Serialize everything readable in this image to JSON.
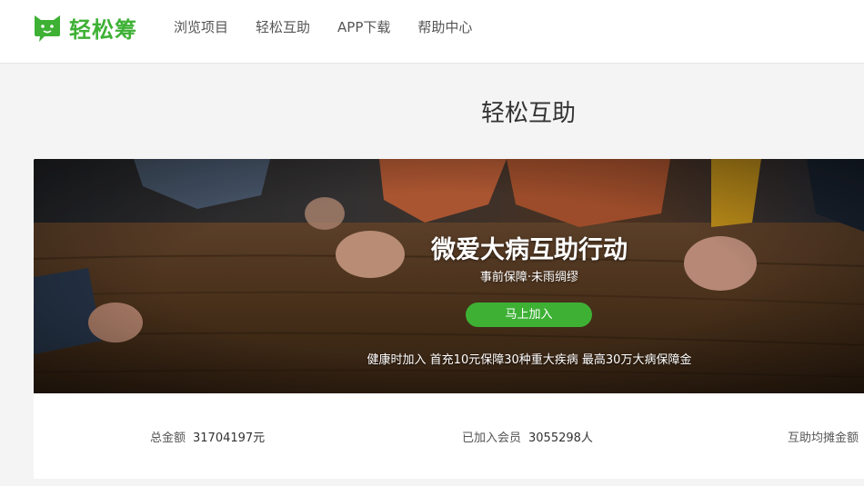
{
  "header": {
    "logo_text": "轻松筹",
    "brand_color": "#3eb135",
    "nav": [
      "浏览项目",
      "轻松互助",
      "APP下载",
      "帮助中心"
    ]
  },
  "page_title": "轻松互助",
  "banner": {
    "title": "微爱大病互助行动",
    "subtitle": "事前保障·未雨绸缪",
    "button": "马上加入",
    "description": "健康时加入 首充10元保障30种重大疾病 最高30万大病保障金"
  },
  "stats": {
    "total_label": "总金额",
    "total_value": "31704197元",
    "members_label": "已加入会员",
    "members_value": "3055298人",
    "avg_label": "互助均摊金额"
  }
}
